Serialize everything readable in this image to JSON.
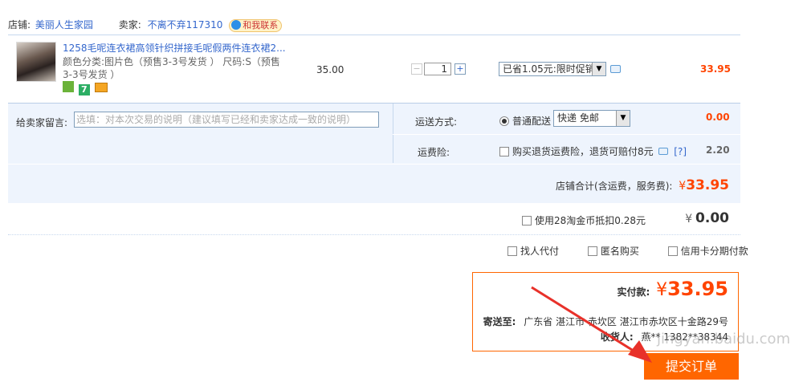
{
  "shop": {
    "shop_label": "店铺:",
    "shop_name": "美丽人生家园",
    "seller_label": "卖家:",
    "seller_name": "不离不弃117310",
    "contact_label": "和我联系"
  },
  "item": {
    "title": "1258毛呢连衣裙高领针织拼接毛呢假两件连衣裙2...",
    "attr_line1": "颜色分类:图片色（预售3-3号发货 ）  尺码:S（预售",
    "attr_line2": "3-3号发货 ）",
    "badge_colors": [
      "#6bb33a",
      "#2cae64",
      "#f5a623"
    ],
    "price": "35.00",
    "qty_minus": "−",
    "quantity": "1",
    "qty_plus": "+",
    "promo_selected": "已省1.05元:限时促销",
    "total": "33.95"
  },
  "message": {
    "label": "给卖家留言:",
    "placeholder": "选填：对本次交易的说明（建议填写已经和卖家达成一致的说明）"
  },
  "shipping": {
    "label": "运送方式:",
    "option": "普通配送",
    "selected": "快递 免邮",
    "cost": "0.00"
  },
  "insurance": {
    "label": "运费险:",
    "text": "购买退货运费险，退货可赔付8元",
    "help": "[?]",
    "cost": "2.20"
  },
  "subtotal": {
    "label": "店铺合计(含运费，服务费):",
    "currency": "¥",
    "amount": "33.95"
  },
  "coins": {
    "text": "使用28淘金币抵扣0.28元",
    "currency": "¥",
    "amount": "0.00"
  },
  "options": {
    "proxy_pay": "找人代付",
    "anonymous": "匿名购买",
    "installment": "信用卡分期付款"
  },
  "summary": {
    "pay_label": "实付款:",
    "currency": "¥",
    "pay_amount": "33.95",
    "ship_to_label": "寄送至:",
    "address": "广东省 湛江市 赤坎区 湛江市赤坎区十金路29号",
    "receiver_label": "收货人:",
    "receiver": "燕**  1382**38344"
  },
  "submit_label": "提交订单",
  "watermark": "jingyan.baidu.com",
  "colors": {
    "accent_orange": "#ff4400",
    "link_blue": "#3366cc",
    "row_bg": "#eef4fd",
    "annotation_red": "#e8312a"
  }
}
